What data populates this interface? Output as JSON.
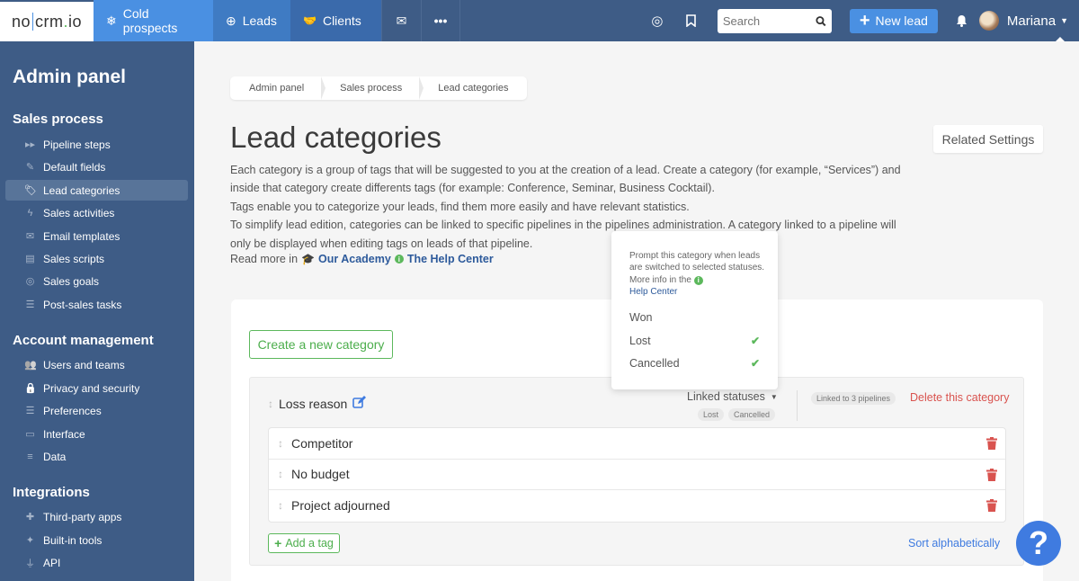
{
  "topbar": {
    "logo": {
      "part1": "no",
      "part2": "crm",
      "dot": ".",
      "part3": "io"
    },
    "tabs": [
      {
        "label": "Cold prospects",
        "icon": "snowflake-icon"
      },
      {
        "label": "Leads",
        "icon": "crosshair-icon"
      },
      {
        "label": "Clients",
        "icon": "handshake-icon"
      }
    ],
    "search_placeholder": "Search",
    "new_lead_label": "New lead",
    "user_name": "Mariana"
  },
  "sidebar": {
    "title": "Admin panel",
    "sections": [
      {
        "title": "Sales process",
        "items": [
          {
            "label": "Pipeline steps",
            "icon": "▸▸"
          },
          {
            "label": "Default fields",
            "icon": "✎"
          },
          {
            "label": "Lead categories",
            "icon": "🏷",
            "active": true
          },
          {
            "label": "Sales activities",
            "icon": "ϟ"
          },
          {
            "label": "Email templates",
            "icon": "✉"
          },
          {
            "label": "Sales scripts",
            "icon": "▤"
          },
          {
            "label": "Sales goals",
            "icon": "◎"
          },
          {
            "label": "Post-sales tasks",
            "icon": "☰"
          }
        ]
      },
      {
        "title": "Account management",
        "items": [
          {
            "label": "Users and teams",
            "icon": "👥"
          },
          {
            "label": "Privacy and security",
            "icon": "🔒"
          },
          {
            "label": "Preferences",
            "icon": "☰"
          },
          {
            "label": "Interface",
            "icon": "▭"
          },
          {
            "label": "Data",
            "icon": "≡"
          }
        ]
      },
      {
        "title": "Integrations",
        "items": [
          {
            "label": "Third-party apps",
            "icon": "✚"
          },
          {
            "label": "Built-in tools",
            "icon": "✦"
          },
          {
            "label": "API",
            "icon": "⏚"
          }
        ]
      }
    ]
  },
  "breadcrumb": [
    "Admin panel",
    "Sales process",
    "Lead categories"
  ],
  "page": {
    "title": "Lead categories",
    "related_settings": "Related Settings",
    "description": [
      "Each category is a group of tags that will be suggested to you at the creation of a lead. Create a category (for example, “Services”) and",
      "inside that category create differents tags (for example: Conference, Seminar, Business Cocktail).",
      "Tags enable you to categorize your leads, find them more easily and have relevant statistics.",
      "To simplify lead edition, categories can be linked to specific pipelines in the pipelines administration. A category linked to a pipeline will",
      "only be displayed when editing tags on leads of that pipeline."
    ],
    "read_more": "Read more in",
    "academy_link": "Our Academy",
    "help_center_link": "The Help Center",
    "create_category": "Create a new category"
  },
  "category": {
    "name": "Loss reason",
    "linked_statuses_label": "Linked statuses",
    "linked_statuses": [
      "Lost",
      "Cancelled"
    ],
    "linked_pipelines": "Linked to 3 pipelines",
    "delete_label": "Delete this category",
    "tags": [
      "Competitor",
      "No budget",
      "Project adjourned"
    ],
    "add_tag": "Add a tag",
    "sort_label": "Sort alphabetically"
  },
  "popover": {
    "text": "Prompt this category when leads are switched to selected statuses. More info in the",
    "link": "Help Center",
    "options": [
      {
        "label": "Won",
        "checked": false
      },
      {
        "label": "Lost",
        "checked": true
      },
      {
        "label": "Cancelled",
        "checked": true
      }
    ]
  },
  "colors": {
    "nav_bg": "#3e5c86",
    "accent_blue": "#4a90e2",
    "green": "#5cb85c",
    "danger": "#d9534f"
  }
}
